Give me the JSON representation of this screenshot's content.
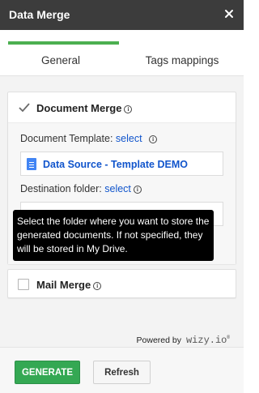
{
  "window": {
    "title": "Data Merge"
  },
  "tabs": [
    {
      "label": "General",
      "active": true
    },
    {
      "label": "Tags mappings",
      "active": false
    }
  ],
  "document_merge": {
    "label": "Document Merge",
    "checked": true,
    "template_label": "Document Template:",
    "template_link": "select",
    "template_file": "Data Source - Template DEMO",
    "destination_label": "Destination folder:",
    "destination_link": "select",
    "tooltip": "Select the folder where you want to store the generated documents. If not specified, they will be stored in My Drive."
  },
  "mail_merge": {
    "label": "Mail Merge",
    "checked": false
  },
  "branding": {
    "powered_by": "Powered by",
    "brand": "wizy.io"
  },
  "footer": {
    "generate_label": "GENERATE",
    "refresh_label": "Refresh"
  },
  "colors": {
    "accent": "#4caf50",
    "generate": "#34a853",
    "link": "#1155cc",
    "titlebar": "#3c3c3c"
  }
}
